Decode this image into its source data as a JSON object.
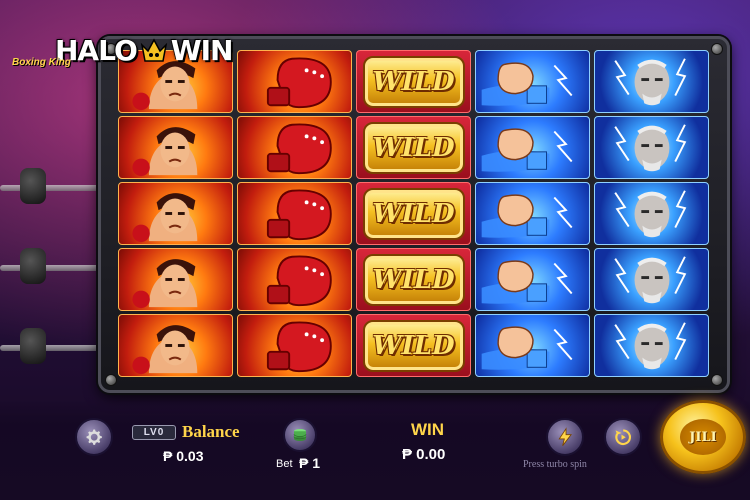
{
  "logo": {
    "left": "HALO",
    "right": "WIN",
    "game_tag": "Boxing King"
  },
  "reels": {
    "columns": [
      {
        "symbol": "boxer-red-icon",
        "theme": "red"
      },
      {
        "symbol": "red-glove-icon",
        "theme": "red"
      },
      {
        "symbol": "wild-icon",
        "theme": "gold",
        "label": "WILD"
      },
      {
        "symbol": "blue-fist-icon",
        "theme": "blue"
      },
      {
        "symbol": "boxer-blue-icon",
        "theme": "blue2"
      }
    ],
    "rows": 5
  },
  "hud": {
    "level": "LV0",
    "balance_label": "Balance",
    "balance_value": "₱ 0.03",
    "bet_label": "Bet",
    "bet_value": "₱ 1",
    "win_label": "WIN",
    "win_value": "₱ 0.00",
    "turbo_hint": "Press turbo spin",
    "spin_label": "JILI"
  },
  "colors": {
    "accent": "#ffd54a",
    "red": "#c21d0e",
    "blue": "#2d7cff",
    "gold": "#f5c021"
  }
}
